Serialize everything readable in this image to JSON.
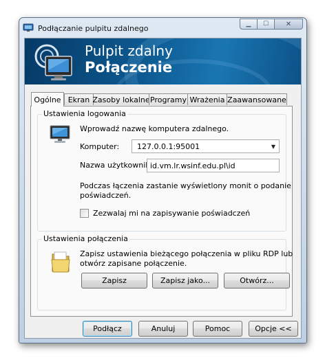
{
  "window": {
    "title": "Podłączanie pulpitu zdalnego",
    "controls": {
      "minimize": "▁",
      "maximize": "☐",
      "close": "✕"
    }
  },
  "banner": {
    "line1": "Pulpit zdalny",
    "line2": "Połączenie"
  },
  "tabs": [
    {
      "label": "Ogólne",
      "active": true
    },
    {
      "label": "Ekran"
    },
    {
      "label": "Zasoby lokalne"
    },
    {
      "label": "Programy"
    },
    {
      "label": "Wrażenia"
    },
    {
      "label": "Zaawansowane"
    }
  ],
  "login_settings": {
    "title": "Ustawienia logowania",
    "prompt": "Wprowadź nazwę komputera zdalnego.",
    "computer_label": "Komputer:",
    "computer_value": "127.0.0.1:95001",
    "username_label": "Nazwa użytkownika:",
    "username_value": "id.vm.lr.wsinf.edu.pl\\id",
    "info_line1": "Podczas łączenia zastanie wyświetlony monit o podanie",
    "info_line2": "poświadczeń.",
    "save_credentials_label": "Zezwalaj mi na zapisywanie poświadczeń",
    "save_credentials_checked": false,
    "icon": "computer-monitor-icon"
  },
  "connection_settings": {
    "title": "Ustawienia połączenia",
    "desc_line1": "Zapisz ustawienia bieżącego połączenia w pliku RDP lub",
    "desc_line2": "otwórz zapisane połączenie.",
    "save_label": "Zapisz",
    "save_as_label": "Zapisz jako...",
    "open_label": "Otwórz...",
    "icon": "folder-icon"
  },
  "footer": {
    "connect_label": "Podłącz",
    "cancel_label": "Anuluj",
    "help_label": "Pomoc",
    "options_label": "Opcje <<"
  }
}
